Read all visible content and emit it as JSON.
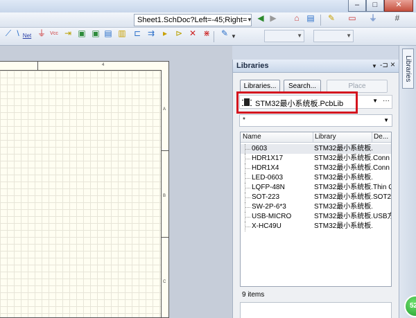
{
  "window": {
    "minimize": "–",
    "maximize": "□",
    "close": "✕"
  },
  "toolbar": {
    "document_path": "Sheet1.SchDoc?Left=-45;Right=",
    "dropdown_glyph": "▼",
    "net_label": "Net",
    "vcc_label": "Vcc"
  },
  "sheet": {
    "zone_top": "4",
    "zone_a": "A",
    "zone_b": "B",
    "zone_c": "C"
  },
  "panel": {
    "title": "Libraries",
    "pin_glyph": "-⊐",
    "close_glyph": "×",
    "menu_glyph": "▼",
    "buttons": {
      "libraries": "Libraries...",
      "search": "Search...",
      "place": "Place"
    },
    "library_select": {
      "value": "STM32最小系统板.PcbLib",
      "more": "···"
    },
    "filter": {
      "value": "*"
    },
    "columns": {
      "name": "Name",
      "library": "Library",
      "description": "De..."
    },
    "items": [
      {
        "name": "0603",
        "library": "STM32最小系统板.",
        "description": ""
      },
      {
        "name": "HDR1X17",
        "library": "STM32最小系统板.",
        "description": "Conn"
      },
      {
        "name": "HDR1X4",
        "library": "STM32最小系统板.",
        "description": "Conn"
      },
      {
        "name": "LED-0603",
        "library": "STM32最小系统板.",
        "description": ""
      },
      {
        "name": "LQFP-48N",
        "library": "STM32最小系统板.",
        "description": "Thin Q"
      },
      {
        "name": "SOT-223",
        "library": "STM32最小系统板.",
        "description": "SOT22"
      },
      {
        "name": "SW-2P-6*3",
        "library": "STM32最小系统板.",
        "description": ""
      },
      {
        "name": "USB-MICRO",
        "library": "STM32最小系统板.",
        "description": "USB方"
      },
      {
        "name": "X-HC49U",
        "library": "STM32最小系统板.",
        "description": ""
      }
    ],
    "count": "9 items"
  },
  "sidebar": {
    "tab": "Libraries"
  },
  "badge": {
    "text": "52"
  },
  "colors": {
    "highlight": "#d4141e",
    "sheet": "#fffef2",
    "canvas": "#c6cdd9"
  }
}
